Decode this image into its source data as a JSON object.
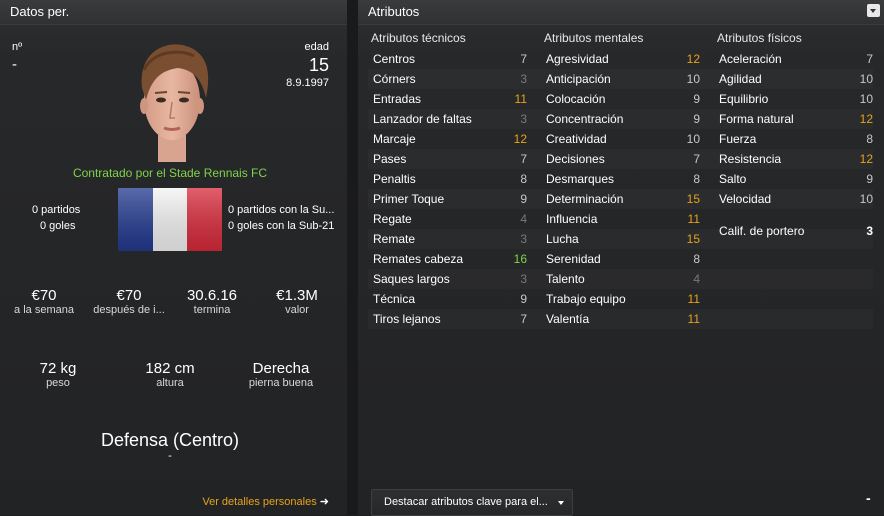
{
  "left": {
    "title": "Datos per.",
    "number_label": "nº",
    "number_value": "-",
    "age_label": "edad",
    "age_value": "15",
    "birth_date": "8.9.1997",
    "contract_text": "Contratado por el Stade Rennais FC",
    "club_apps": "0 partidos",
    "club_goals": "0 goles",
    "intl_apps": "0 partidos con la Su...",
    "intl_goals": "0 goles con la Sub-21",
    "finances": [
      {
        "value": "€70",
        "label": "a la semana"
      },
      {
        "value": "€70",
        "label": "después de i..."
      },
      {
        "value": "30.6.16",
        "label": "termina"
      },
      {
        "value": "€1.3M",
        "label": "valor"
      }
    ],
    "physical": [
      {
        "value": "72 kg",
        "label": "peso"
      },
      {
        "value": "182 cm",
        "label": "altura"
      },
      {
        "value": "Derecha",
        "label": "pierna buena"
      }
    ],
    "position": "Defensa (Centro)",
    "position_sub": "-",
    "details_link": "Ver detalles personales",
    "colors": {
      "contract_green": "#7fd44a",
      "link_orange": "#e8a21a"
    }
  },
  "right": {
    "title": "Atributos",
    "columns": [
      {
        "title": "Atributos técnicos",
        "attrs": [
          {
            "name": "Centros",
            "value": "7"
          },
          {
            "name": "Córners",
            "value": "3"
          },
          {
            "name": "Entradas",
            "value": "11"
          },
          {
            "name": "Lanzador de faltas",
            "value": "3"
          },
          {
            "name": "Marcaje",
            "value": "12"
          },
          {
            "name": "Pases",
            "value": "7"
          },
          {
            "name": "Penaltis",
            "value": "8"
          },
          {
            "name": "Primer Toque",
            "value": "9"
          },
          {
            "name": "Regate",
            "value": "4"
          },
          {
            "name": "Remate",
            "value": "3"
          },
          {
            "name": "Remates cabeza",
            "value": "16"
          },
          {
            "name": "Saques largos",
            "value": "3"
          },
          {
            "name": "Técnica",
            "value": "9"
          },
          {
            "name": "Tiros lejanos",
            "value": "7"
          }
        ]
      },
      {
        "title": "Atributos mentales",
        "attrs": [
          {
            "name": "Agresividad",
            "value": "12"
          },
          {
            "name": "Anticipación",
            "value": "10"
          },
          {
            "name": "Colocación",
            "value": "9"
          },
          {
            "name": "Concentración",
            "value": "9"
          },
          {
            "name": "Creatividad",
            "value": "10"
          },
          {
            "name": "Decisiones",
            "value": "7"
          },
          {
            "name": "Desmarques",
            "value": "8"
          },
          {
            "name": "Determinación",
            "value": "15"
          },
          {
            "name": "Influencia",
            "value": "11"
          },
          {
            "name": "Lucha",
            "value": "15"
          },
          {
            "name": "Serenidad",
            "value": "8"
          },
          {
            "name": "Talento",
            "value": "4"
          },
          {
            "name": "Trabajo equipo",
            "value": "11"
          },
          {
            "name": "Valentía",
            "value": "11"
          }
        ]
      },
      {
        "title": "Atributos físicos",
        "attrs": [
          {
            "name": "Aceleración",
            "value": "7"
          },
          {
            "name": "Agilidad",
            "value": "10"
          },
          {
            "name": "Equilibrio",
            "value": "10"
          },
          {
            "name": "Forma natural",
            "value": "12"
          },
          {
            "name": "Fuerza",
            "value": "8"
          },
          {
            "name": "Resistencia",
            "value": "12"
          },
          {
            "name": "Salto",
            "value": "9"
          },
          {
            "name": "Velocidad",
            "value": "10"
          }
        ]
      }
    ],
    "goalkeeper_label": "Calif. de portero",
    "goalkeeper_value": "3",
    "highlight_label": "Destacar atributos clave para el...",
    "minus_label": "-"
  }
}
